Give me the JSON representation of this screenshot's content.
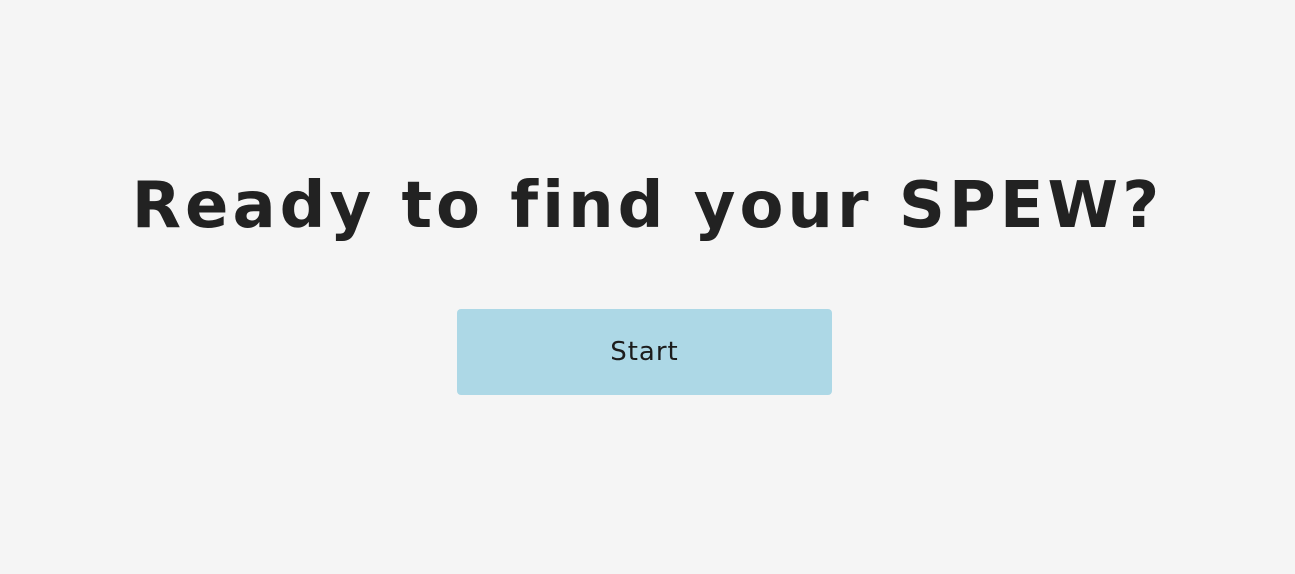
{
  "landing": {
    "headline": "Ready to find your SPEW?",
    "start_label": "Start"
  },
  "colors": {
    "background": "#f5f5f5",
    "headline_text": "#222222",
    "button_background": "#add8e6",
    "button_text": "#1c1c1c"
  }
}
